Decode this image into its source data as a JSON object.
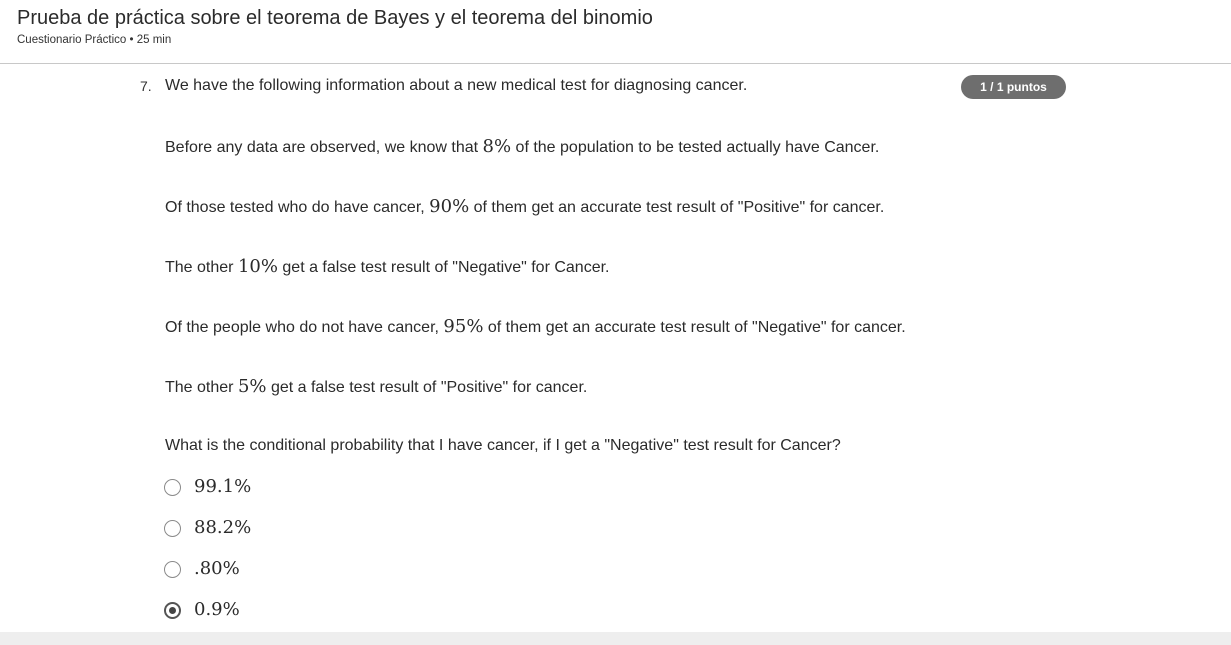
{
  "header": {
    "title": "Prueba de práctica sobre el teorema de Bayes y el teorema del binomio",
    "meta": "Cuestionario Práctico • 25 min"
  },
  "question": {
    "number": "7.",
    "score": "1 / 1 puntos",
    "intro": "We have the following information about a new medical test for diagnosing cancer.",
    "p1": {
      "before": "Before any data are observed, we know that ",
      "math": "8%",
      "after": " of the population to be tested actually have Cancer."
    },
    "p2": {
      "before": "Of those tested who do have cancer, ",
      "math": "90%",
      "after": " of them get an accurate test result of \"Positive\" for cancer."
    },
    "p3": {
      "before": "The other ",
      "math": "10%",
      "after": " get a false test result of \"Negative\" for Cancer."
    },
    "p4": {
      "before": "Of the people who do not have cancer, ",
      "math": "95%",
      "after": " of them get an accurate test result of \"Negative\" for cancer."
    },
    "p5": {
      "before": "The other ",
      "math": "5%",
      "after": " get a false test result of \"Positive\" for cancer."
    },
    "prompt": "What is the conditional probability that I have cancer, if I get a \"Negative\" test result for Cancer?",
    "options": [
      {
        "label": "99.1%",
        "selected": false
      },
      {
        "label": "88.2%",
        "selected": false
      },
      {
        "label": ".80%",
        "selected": false
      },
      {
        "label": "0.9%",
        "selected": true
      }
    ]
  }
}
